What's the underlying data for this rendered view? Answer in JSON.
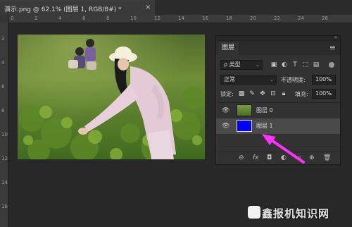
{
  "tab": {
    "label": "演示.png @ 62.1% (图层 1, RGB/8#) *",
    "close": "×"
  },
  "ruler_top": [
    "0",
    "2",
    "4",
    "6",
    "8",
    "10",
    "12",
    "14",
    "16",
    "18",
    "20",
    "22",
    "24",
    "26"
  ],
  "ruler_left": [
    "2",
    "4",
    "6",
    "8",
    "10",
    "12",
    "14",
    "16"
  ],
  "panel": {
    "collapse": "»",
    "tab_title": "图层",
    "menu_icon": "≡",
    "filter_select": "ρ 类型",
    "filter_icons": [
      "image-filter-icon",
      "adjustment-filter-icon",
      "text-filter-icon",
      "shape-filter-icon",
      "smart-object-filter-icon"
    ],
    "blend_mode": "正常",
    "opacity_label": "不透明度:",
    "opacity_value": "100%",
    "lock_label": "锁定:",
    "lock_icons": [
      "lock-transparent-icon",
      "lock-image-icon",
      "lock-position-icon",
      "lock-artboard-icon",
      "lock-all-icon"
    ],
    "fill_label": "填充:",
    "fill_value": "100%",
    "layers": [
      {
        "name": "图层 0",
        "thumb": "photo",
        "selected": false
      },
      {
        "name": "图层 1",
        "thumb": "#0000ff",
        "selected": true
      }
    ],
    "bottom_icons": [
      "link-icon",
      "fx-icon",
      "mask-icon",
      "adjustment-icon",
      "folder-icon",
      "new-layer-icon",
      "trash-icon"
    ],
    "bottom_labels": {
      "link": "⊖",
      "fx": "fx",
      "mask": "◘",
      "adjust": "◐",
      "folder": "▭",
      "new": "⊕",
      "trash": "🗑"
    }
  },
  "watermark": {
    "text": "鑫报机知识网"
  },
  "colors": {
    "accent_arrow": "#ff33ff",
    "layer1_fill": "#0000ff",
    "selected_row": "#4a4a4a"
  }
}
